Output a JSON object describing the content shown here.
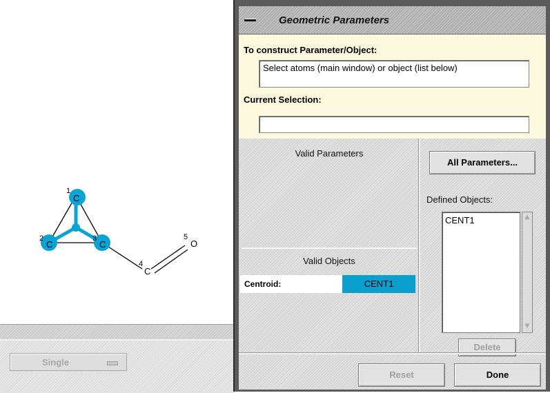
{
  "molecule": {
    "atoms": [
      {
        "number": "1",
        "symbol": "C"
      },
      {
        "number": "2",
        "symbol": "C"
      },
      {
        "number": "3",
        "symbol": "C"
      },
      {
        "number": "4",
        "symbol": "C"
      },
      {
        "number": "5",
        "symbol": "O"
      }
    ],
    "selected_color": "#0aa3d6"
  },
  "main_window": {
    "mode_selector": "Single"
  },
  "dialog": {
    "title": "Geometric Parameters",
    "construct_label": "To construct Parameter/Object:",
    "instruction": "Select atoms (main window) or object (list below)",
    "current_selection_label": "Current Selection:",
    "current_selection_value": "",
    "valid_parameters_label": "Valid Parameters",
    "all_parameters_button": "All Parameters...",
    "defined_objects_label": "Defined Objects:",
    "defined_objects": [
      "CENT1"
    ],
    "valid_objects_label": "Valid Objects",
    "valid_objects": [
      {
        "type": "Centroid:",
        "value": "CENT1"
      }
    ],
    "delete_button": "Delete",
    "reset_button": "Reset",
    "done_button": "Done",
    "highlight_color": "#0a9fcc",
    "panel_color": "#fdf9de"
  }
}
